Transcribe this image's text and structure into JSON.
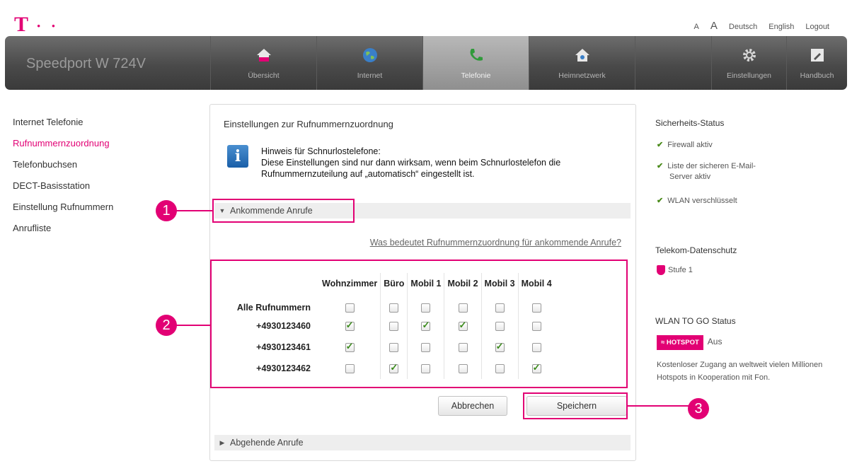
{
  "logo": {
    "letter": "T",
    "dots": "· ·"
  },
  "top_links": {
    "small_a": "A",
    "large_a": "A",
    "lang_de": "Deutsch",
    "lang_en": "English",
    "logout": "Logout"
  },
  "nav": {
    "brand": "Speedport W 724V",
    "items": [
      {
        "label": "Übersicht",
        "icon": "house-icon"
      },
      {
        "label": "Internet",
        "icon": "globe-icon"
      },
      {
        "label": "Telefonie",
        "icon": "phone-icon"
      },
      {
        "label": "Heimnetzwerk",
        "icon": "home-network-icon"
      },
      {
        "label": "Einstellungen",
        "icon": "gear-icon"
      },
      {
        "label": "Handbuch",
        "icon": "manual-icon"
      }
    ],
    "active": "Telefonie"
  },
  "sidebar": {
    "items": [
      {
        "label": "Internet Telefonie"
      },
      {
        "label": "Rufnummernzuordnung"
      },
      {
        "label": "Telefonbuchsen"
      },
      {
        "label": "DECT-Basisstation"
      },
      {
        "label": "Einstellung Rufnummern"
      },
      {
        "label": "Anrufliste"
      }
    ],
    "active": "Rufnummernzuordnung"
  },
  "panel": {
    "title": "Einstellungen zur Rufnummernzuordnung",
    "hint_title": "Hinweis für Schnurlostelefone:",
    "hint_text": "Diese Einstellungen sind nur dann wirksam, wenn beim Schnurlostelefon die Rufnummernzuteilung auf „automatisch“ eingestellt ist.",
    "section_incoming": "Ankommende Anrufe",
    "faq_link": "Was bedeutet Rufnummernzuordnung für ankommende Anrufe?",
    "section_outgoing": "Abgehende Anrufe",
    "cancel_label": "Abbrechen",
    "save_label": "Speichern"
  },
  "assignment_table": {
    "columns": [
      "Wohnzimmer",
      "Büro",
      "Mobil 1",
      "Mobil 2",
      "Mobil 3",
      "Mobil 4"
    ],
    "rows": [
      {
        "label": "Alle Rufnummern",
        "checked": [
          false,
          false,
          false,
          false,
          false,
          false
        ]
      },
      {
        "label": "+4930123460",
        "checked": [
          true,
          false,
          true,
          true,
          false,
          false
        ]
      },
      {
        "label": "+4930123461",
        "checked": [
          true,
          false,
          false,
          false,
          true,
          false
        ]
      },
      {
        "label": "+4930123462",
        "checked": [
          false,
          true,
          false,
          false,
          false,
          true
        ]
      }
    ]
  },
  "callouts": [
    "1",
    "2",
    "3"
  ],
  "security": {
    "title": "Sicherheits-Status",
    "items": [
      "Firewall aktiv",
      "Liste der sicheren E-Mail-Server aktiv",
      "WLAN verschlüsselt"
    ]
  },
  "privacy": {
    "title": "Telekom-Datenschutz",
    "level": "Stufe 1"
  },
  "wlan_to_go": {
    "title": "WLAN TO GO Status",
    "badge": "HOTSPOT",
    "status": "Aus",
    "desc": "Kostenloser Zugang an weltweit vielen Millionen Hotspots in Kooperation mit Fon."
  },
  "colors": {
    "brand": "#e20074",
    "nav_bg": "#4a4a4a",
    "check": "#3a8a1a"
  }
}
